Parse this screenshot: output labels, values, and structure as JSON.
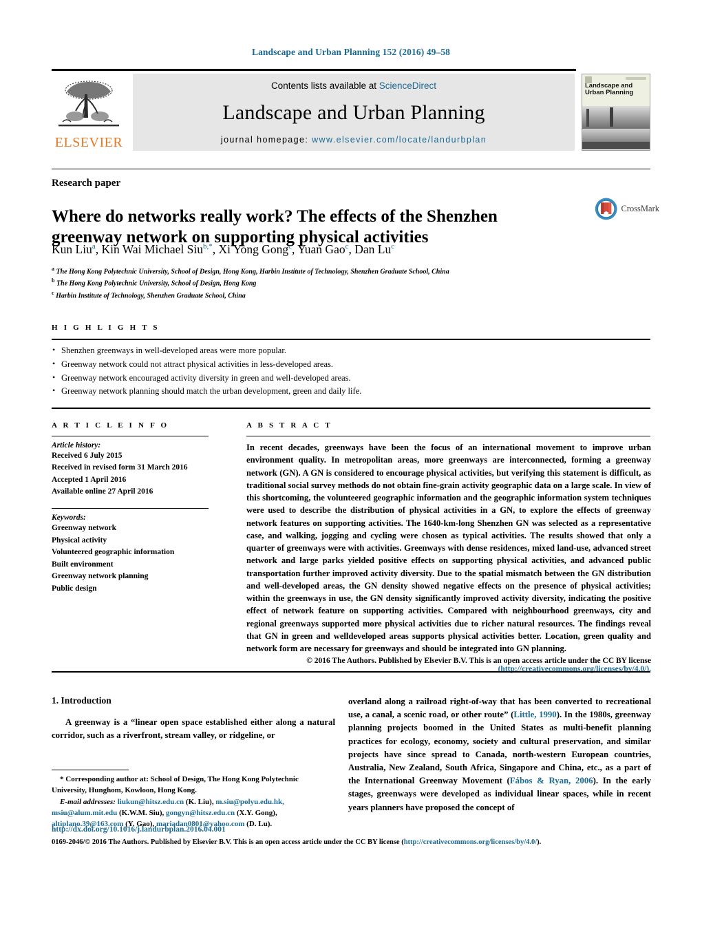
{
  "running_head": "Landscape and Urban Planning 152 (2016) 49–58",
  "masthead": {
    "contents_prefix": "Contents lists available at ",
    "sciencedirect": "ScienceDirect",
    "journal_name": "Landscape and Urban Planning",
    "homepage_prefix": "journal homepage: ",
    "homepage_url": "www.elsevier.com/locate/landurbplan",
    "publisher": "ELSEVIER",
    "cover_title": "Landscape and Urban Planning",
    "accent_color": "#1b6a93",
    "publisher_color": "#e87722"
  },
  "article": {
    "type": "Research paper",
    "title": "Where do networks really work? The effects of the Shenzhen greenway network on supporting physical activities",
    "authors_html": "Kun Liu<sup>a</sup>, Kin Wai Michael Siu<sup>b,*</sup>, Xi Yong Gong<sup>c</sup>, Yuan Gao<sup>c</sup>, Dan Lu<sup>c</sup>",
    "affiliations": [
      {
        "marker": "a",
        "text": "The Hong Kong Polytechnic University, School of Design, Hong Kong, Harbin Institute of Technology, Shenzhen Graduate School, China"
      },
      {
        "marker": "b",
        "text": "The Hong Kong Polytechnic University, School of Design, Hong Kong"
      },
      {
        "marker": "c",
        "text": "Harbin Institute of Technology, Shenzhen Graduate School, China"
      }
    ],
    "crossmark_label": "CrossMark"
  },
  "highlights": {
    "heading": "H I G H L I G H T S",
    "items": [
      "Shenzhen greenways in well-developed areas were more popular.",
      "Greenway network could not attract physical activities in less-developed areas.",
      "Greenway network encouraged activity diversity in green and well-developed areas.",
      "Greenway network planning should match the urban development, green and daily life."
    ]
  },
  "article_info": {
    "heading": "A R T I C L E   I N F O",
    "history_label": "Article history:",
    "history": [
      "Received 6 July 2015",
      "Received in revised form 31 March 2016",
      "Accepted 1 April 2016",
      "Available online 27 April 2016"
    ],
    "keywords_label": "Keywords:",
    "keywords": [
      "Greenway network",
      "Physical activity",
      "Volunteered geographic information",
      "Built environment",
      "Greenway network planning",
      "Public design"
    ]
  },
  "abstract": {
    "heading": "A B S T R A C T",
    "text": "In recent decades, greenways have been the focus of an international movement to improve urban environment quality. In metropolitan areas, more greenways are interconnected, forming a greenway network (GN). A GN is considered to encourage physical activities, but verifying this statement is difficult, as traditional social survey methods do not obtain fine-grain activity geographic data on a large scale. In view of this shortcoming, the volunteered geographic information and the geographic information system techniques were used to describe the distribution of physical activities in a GN, to explore the effects of greenway network features on supporting activities. The 1640-km-long Shenzhen GN was selected as a representative case, and walking, jogging and cycling were chosen as typical activities. The results showed that only a quarter of greenways were with activities. Greenways with dense residences, mixed land-use, advanced street network and large parks yielded positive effects on supporting physical activities, and advanced public transportation further improved activity diversity. Due to the spatial mismatch between the GN distribution and well-developed areas, the GN density showed negative effects on the presence of physical activities; within the greenways in use, the GN density significantly improved activity diversity, indicating the positive effect of network feature on supporting activities. Compared with neighbourhood greenways, city and regional greenways supported more physical activities due to richer natural resources. The findings reveal that GN in green and welldeveloped areas supports physical activities better. Location, green quality and network form are necessary for greenways and should be integrated into GN planning.",
    "copyright_text": "© 2016 The Authors. Published by Elsevier B.V. This is an open access article under the CC BY license",
    "license_url": "(http://creativecommons.org/licenses/by/4.0/)."
  },
  "body": {
    "section_number_title": "1.  Introduction",
    "left_paragraph": "A greenway is a “linear open space established either along a natural corridor, such as a riverfront, stream valley, or ridgeline, or",
    "right_paragraph_part1": "overland along a railroad right-of-way that has been converted to recreational use, a canal, a scenic road, or other route” (",
    "right_ref1": "Little, 1990",
    "right_paragraph_part2": "). In the 1980s, greenway planning projects boomed in the United States as multi-benefit planning practices for ecology, economy, society and cultural preservation, and similar projects have since spread to Canada, north-western European countries, Australia, New Zealand, South Africa, Singapore and China, etc., as a part of the International Greenway Movement (",
    "right_ref2": "Fábos & Ryan, 2006",
    "right_paragraph_part3": "). In the early stages, greenways were developed as individual linear spaces, while in recent years planners have proposed the concept of"
  },
  "footnote": {
    "corresponding": "*  Corresponding author at: School of Design, The Hong Kong Polytechnic University, Hunghom, Kowloon, Hong Kong.",
    "email_label": "E-mail addresses:",
    "emails": [
      {
        "address": "liukun@hitsz.edu.cn",
        "owner": "(K. Liu),"
      },
      {
        "address": "m.siu@polyu.edu.hk,",
        "owner": ""
      },
      {
        "address": "msiu@alum.mit.edu",
        "owner": "(K.W.M. Siu),"
      },
      {
        "address": "gongyn@hitsz.edu.cn",
        "owner": "(X.Y. Gong),"
      },
      {
        "address": "altiplano.39@163.com",
        "owner": "(Y. Gao),"
      },
      {
        "address": "mariadan0801@yahoo.com",
        "owner": "(D. Lu)."
      }
    ]
  },
  "footer": {
    "doi": "http://dx.doi.org/10.1016/j.landurbplan.2016.04.001",
    "issn_copyright": "0169-2046/© 2016 The Authors. Published by Elsevier B.V. This is an open access article under the CC BY license (",
    "license_url": "http://creativecommons.org/licenses/by/4.0/",
    "license_tail": ")."
  }
}
